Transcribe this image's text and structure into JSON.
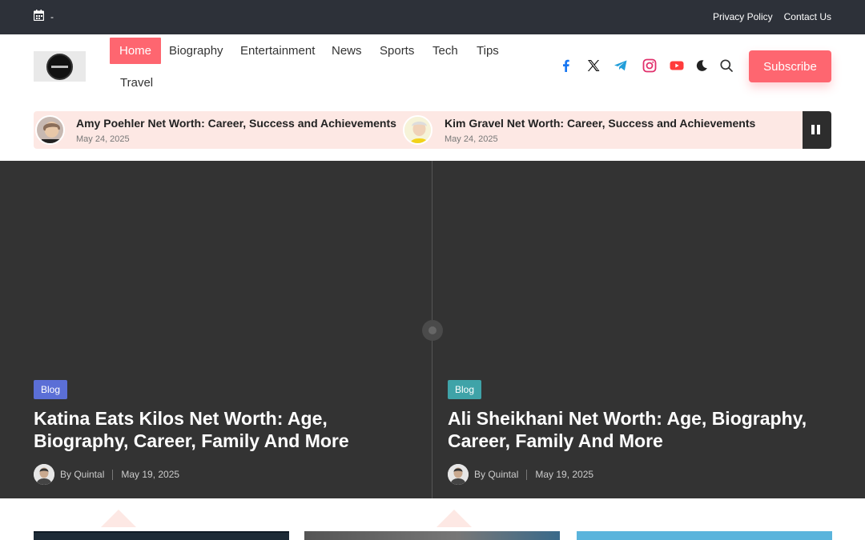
{
  "topbar": {
    "date_text": "-",
    "links": [
      "Privacy Policy",
      "Contact Us"
    ]
  },
  "nav": {
    "items": [
      "Home",
      "Biography",
      "Entertainment",
      "News",
      "Sports",
      "Tech",
      "Tips",
      "Travel"
    ],
    "active": "Home"
  },
  "social_icons": [
    "facebook-icon",
    "x-icon",
    "telegram-icon",
    "instagram-icon",
    "youtube-icon",
    "moon-icon",
    "search-icon"
  ],
  "subscribe_label": "Subscribe",
  "ticker": {
    "items": [
      {
        "title": "Amy Poehler Net Worth: Career, Success and Achievements",
        "date": "May 24, 2025"
      },
      {
        "title": "Kim Gravel Net Worth: Career, Success and Achievements",
        "date": "May 24, 2025"
      }
    ]
  },
  "hero": {
    "cards": [
      {
        "category": "Blog",
        "title": "Katina Eats Kilos Net Worth: Age, Biography, Career, Family And More",
        "author": "By Quintal",
        "date": "May 19, 2025",
        "badge_color": "#5b6fd6"
      },
      {
        "category": "Blog",
        "title": "Ali Sheikhani Net Worth: Age, Biography, Career, Family And More",
        "author": "By Quintal",
        "date": "May 19, 2025",
        "badge_color": "#3fa3a8"
      }
    ]
  },
  "colors": {
    "accent": "#fe6670",
    "topbar": "#2d3139",
    "hero_bg": "#333333",
    "ticker_bg": "#fde8e4"
  }
}
